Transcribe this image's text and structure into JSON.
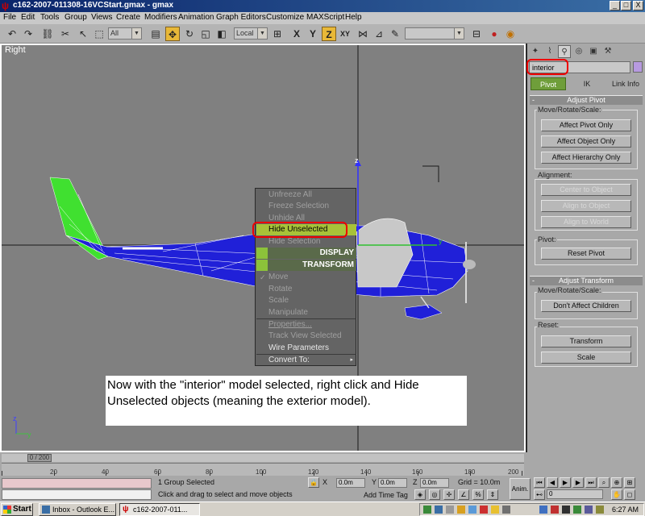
{
  "window": {
    "title": "c162-2007-011308-16VCStart.gmax - gmax",
    "buttons": [
      "_",
      "□",
      "X"
    ]
  },
  "menu": [
    "File",
    "Edit",
    "Tools",
    "Group",
    "Views",
    "Create",
    "Modifiers",
    "Animation",
    "Graph Editors",
    "Customize",
    "MAXScript",
    "Help"
  ],
  "toolbar": {
    "selection_filter": "All",
    "coord_system": "Local",
    "axis_labels": [
      "X",
      "Y",
      "Z",
      "XY"
    ]
  },
  "viewport": {
    "label": "Right",
    "axis_z": "z",
    "axis_y": "y",
    "gizmo_y": "y",
    "corner_z": "z",
    "corner_y": "y"
  },
  "context_menu": {
    "items_top": [
      "Unfreeze All",
      "Freeze Selection",
      "Unhide All",
      "Hide Unselected",
      "Hide Selection"
    ],
    "head_display": "DISPLAY",
    "head_transform": "TRANSFORM",
    "check": "✓",
    "items_bottom": [
      "Move",
      "Rotate",
      "Scale",
      "Manipulate",
      "Properties...",
      "Track View Selected",
      "Wire Parameters",
      "Convert To:"
    ],
    "submenu_arrow": "▸"
  },
  "command_panel": {
    "object_name": "interior",
    "subtabs": [
      "Pivot",
      "IK",
      "Link Info"
    ],
    "adjust_pivot": {
      "title": "Adjust Pivot",
      "move_group": "Move/Rotate/Scale:",
      "buttons": [
        "Affect Pivot Only",
        "Affect Object Only",
        "Affect Hierarchy Only"
      ],
      "alignment_group": "Alignment:",
      "align_buttons": [
        "Center to Object",
        "Align to Object",
        "Align to World"
      ],
      "pivot_group": "Pivot:",
      "pivot_button": "Reset Pivot"
    },
    "adjust_transform": {
      "title": "Adjust Transform",
      "move_group": "Move/Rotate/Scale:",
      "button": "Don't Affect Children",
      "reset_group": "Reset:",
      "reset_buttons": [
        "Transform",
        "Scale"
      ]
    },
    "rollout_minus": "-"
  },
  "timeline": {
    "frame_label": "0 / 200",
    "ticks": [
      "20",
      "40",
      "60",
      "80",
      "100",
      "120",
      "140",
      "160",
      "180",
      "200"
    ]
  },
  "status": {
    "selection": "1 Group Selected",
    "prompt": "Click and drag to select and move objects",
    "x_label": "X",
    "x_value": "0.0m",
    "y_label": "Y",
    "y_value": "0.0m",
    "z_label": "Z",
    "z_value": "0.0m",
    "grid": "Grid = 10.0m",
    "add_time_tag": "Add Time Tag",
    "anim": "Anim.",
    "frame": "0"
  },
  "caption": "Now with the \"interior\" model selected, right click and Hide Unselected objects (meaning the exterior model).",
  "taskbar": {
    "start": "Start",
    "tasks": [
      "Inbox - Outlook E...",
      "c162-2007-011..."
    ],
    "clock": "6:27 AM"
  }
}
